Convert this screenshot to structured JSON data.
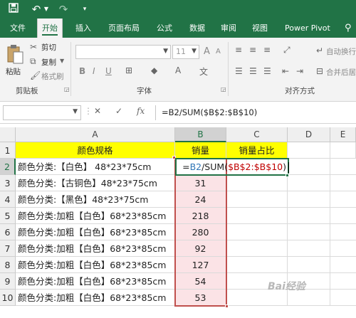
{
  "title_bar": {
    "icons": [
      "save-icon",
      "undo-icon",
      "redo-icon",
      "customize-icon"
    ]
  },
  "tabs": [
    {
      "label": "文件",
      "active": false
    },
    {
      "label": "开始",
      "active": true
    },
    {
      "label": "插入",
      "active": false
    },
    {
      "label": "页面布局",
      "active": false
    },
    {
      "label": "公式",
      "active": false
    },
    {
      "label": "数据",
      "active": false
    },
    {
      "label": "审阅",
      "active": false
    },
    {
      "label": "视图",
      "active": false
    },
    {
      "label": "Power Pivot",
      "active": false
    }
  ],
  "ribbon": {
    "clipboard": {
      "paste": "粘贴",
      "cut": "剪切",
      "copy": "复制",
      "format_painter": "格式刷",
      "group_label": "剪贴板"
    },
    "font": {
      "font_name": "",
      "font_size": "11",
      "bold": "B",
      "italic": "I",
      "underline": "U",
      "grow": "A",
      "shrink": "A",
      "group_label": "字体"
    },
    "alignment": {
      "wrap_text": "自动换行",
      "merge_center": "合并后居",
      "group_label": "对齐方式"
    }
  },
  "formula_bar": {
    "name_box": "",
    "cancel": "✕",
    "enter": "✓",
    "fx": "fx",
    "formula": "=B2/SUM($B$2:$B$10)"
  },
  "sheet": {
    "columns": [
      "A",
      "B",
      "C",
      "D",
      "E"
    ],
    "rows": [
      "1",
      "2",
      "3",
      "4",
      "5",
      "6",
      "7",
      "8",
      "9",
      "10"
    ],
    "header_row": {
      "a": "颜色规格",
      "b": "销量",
      "c": "销量占比"
    },
    "data": [
      {
        "a": "颜色分类:【白色】 48*23*75cm",
        "b": ""
      },
      {
        "a": "颜色分类:【古铜色】48*23*75cm",
        "b": "31"
      },
      {
        "a": "颜色分类:【黑色】48*23*75cm",
        "b": "24"
      },
      {
        "a": "颜色分类:加粗【白色】68*23*85cm",
        "b": "218"
      },
      {
        "a": "颜色分类:加粗【白色】68*23*85cm",
        "b": "280"
      },
      {
        "a": "颜色分类:加粗【白色】68*23*85cm",
        "b": "92"
      },
      {
        "a": "颜色分类:加粗【白色】68*23*85cm",
        "b": "127"
      },
      {
        "a": "颜色分类:加粗【白色】68*23*85cm",
        "b": "54"
      },
      {
        "a": "颜色分类:加粗【白色】68*23*85cm",
        "b": "53"
      }
    ],
    "editing_cell": {
      "eq": "=",
      "ref": "B2",
      "fn": "/SUM(",
      "range": "$B$2:$B$10",
      "close": ")"
    },
    "colors": {
      "header_fill": "#ffff00",
      "selection_border": "#c0504d",
      "accent": "#217346"
    }
  },
  "watermark": "Bai经验"
}
